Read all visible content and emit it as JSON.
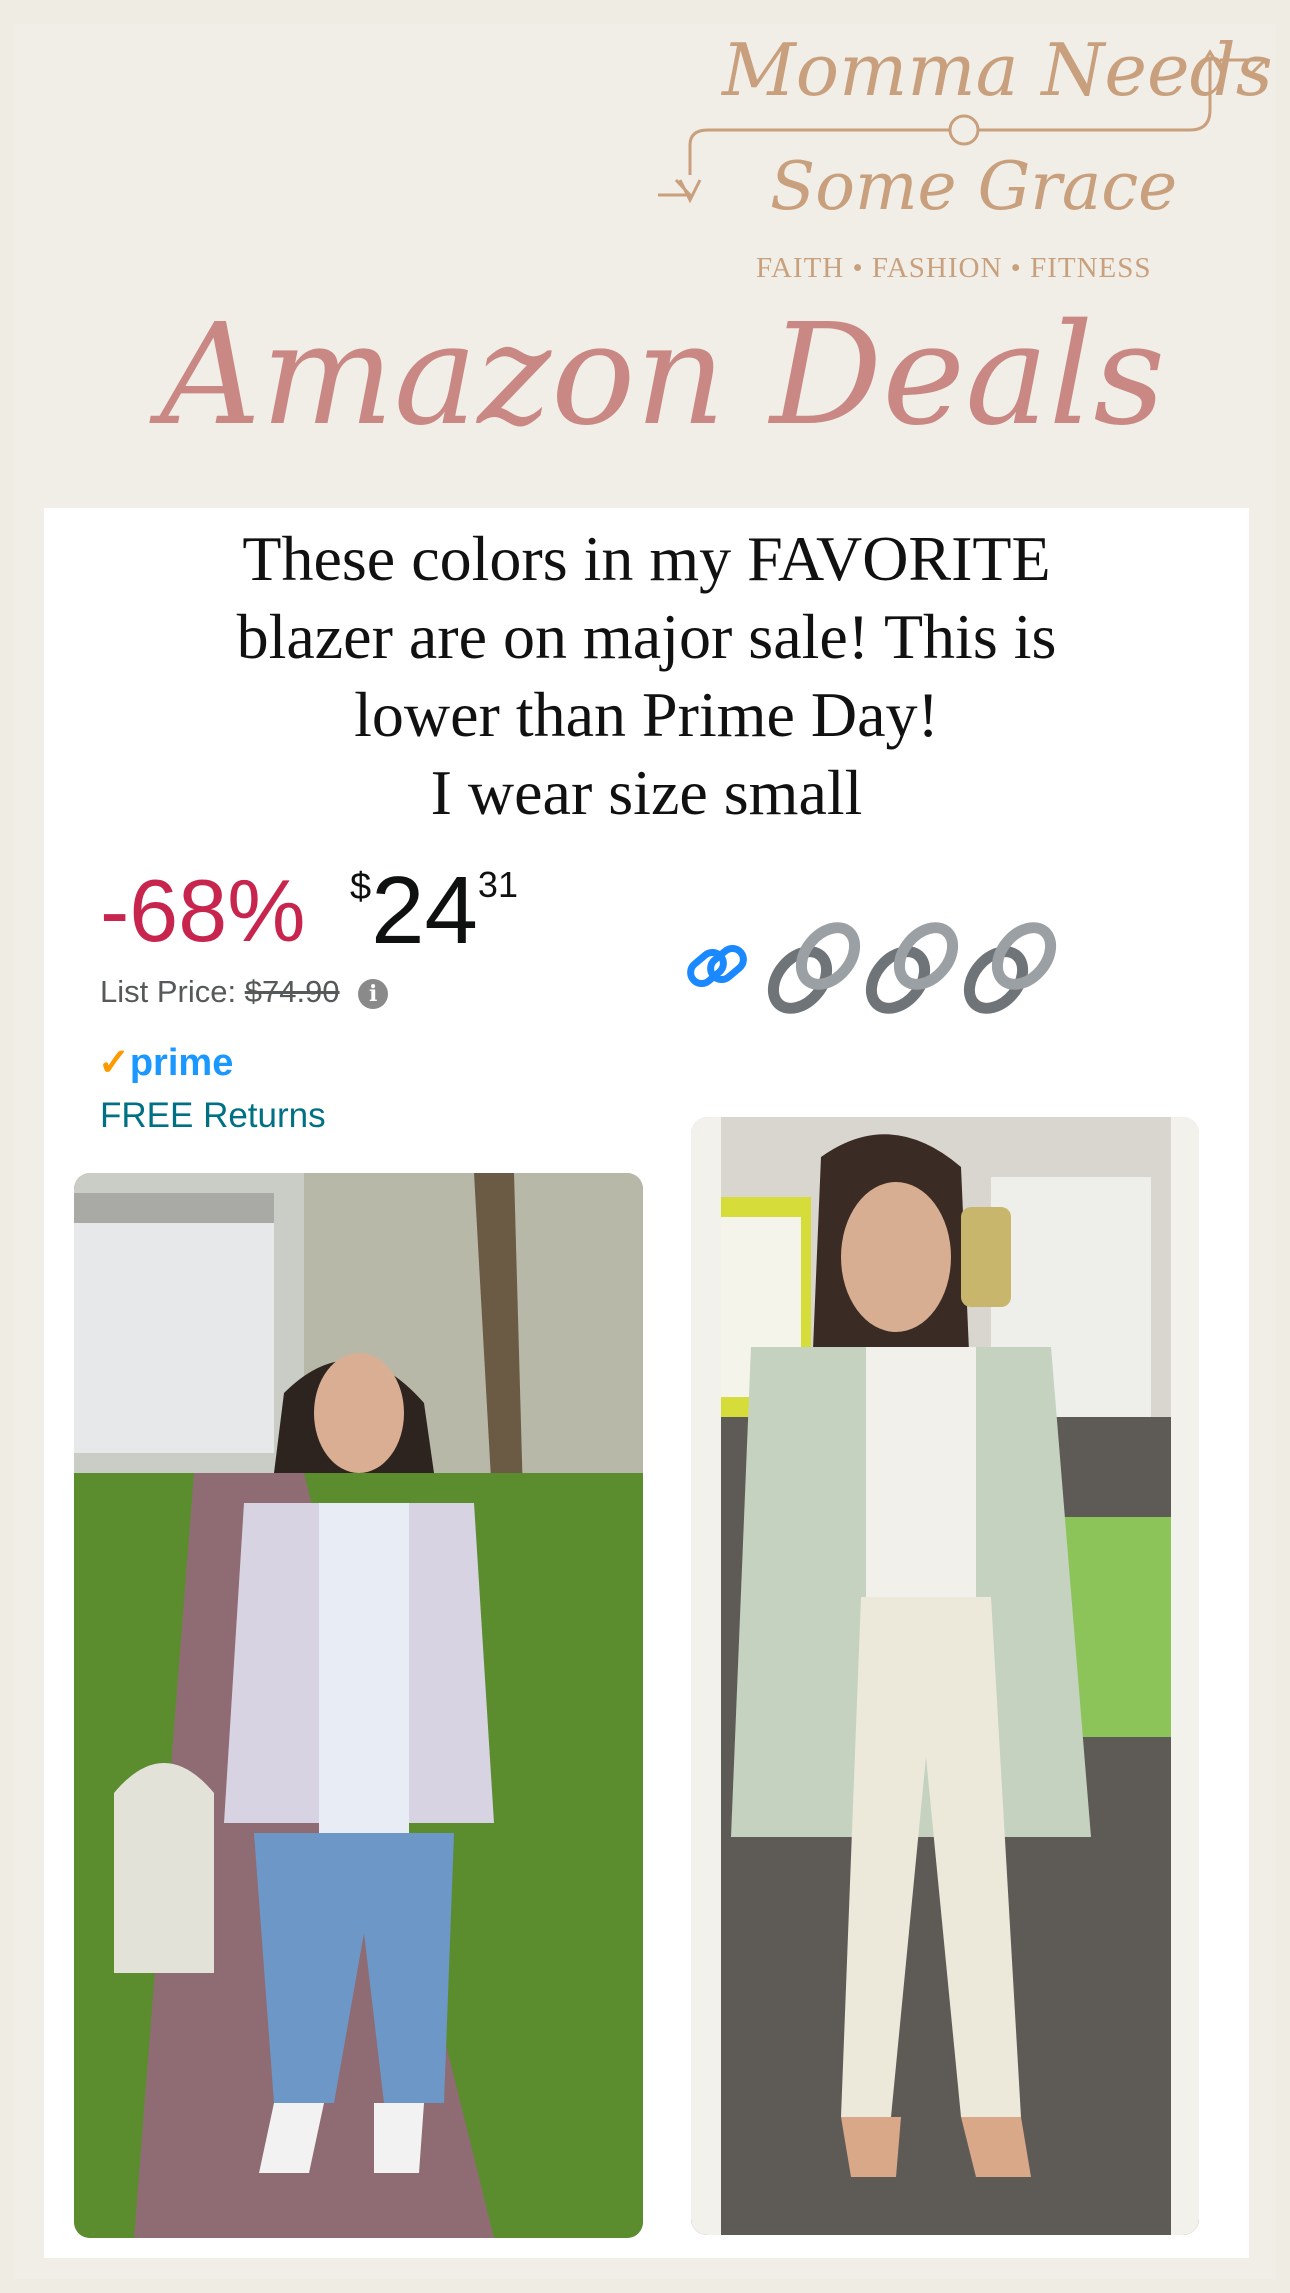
{
  "logo": {
    "line1": "Momma Needs",
    "line2": "Some Grace",
    "tagline": "FAITH • FASHION • FITNESS"
  },
  "title": "Amazon Deals",
  "headline": {
    "lines": [
      "These colors in my FAVORITE",
      "blazer are on major sale! This is",
      "lower than Prime Day!",
      "I wear size small"
    ]
  },
  "deal": {
    "discount": "-68%",
    "currency": "$",
    "price_whole": "24",
    "price_fraction": "31",
    "list_price_label": "List Price:",
    "list_price": "$74.90",
    "prime_check": "✓",
    "prime_label": "prime",
    "returns": "FREE Returns"
  },
  "icons": {
    "link": "link-icon",
    "chains": [
      "chain-link-icon",
      "chain-link-icon",
      "chain-link-icon"
    ],
    "info": "info-icon"
  },
  "colors": {
    "background": "#efece4",
    "logo": "#c9a07d",
    "title": "#c98884",
    "discount": "#c7254e",
    "prime": "#1a98ff",
    "returns": "#007185"
  },
  "photos": {
    "left": "outfit-photo-lavender-blazer",
    "right": "outfit-photo-sage-blazer-mirror-selfie"
  }
}
